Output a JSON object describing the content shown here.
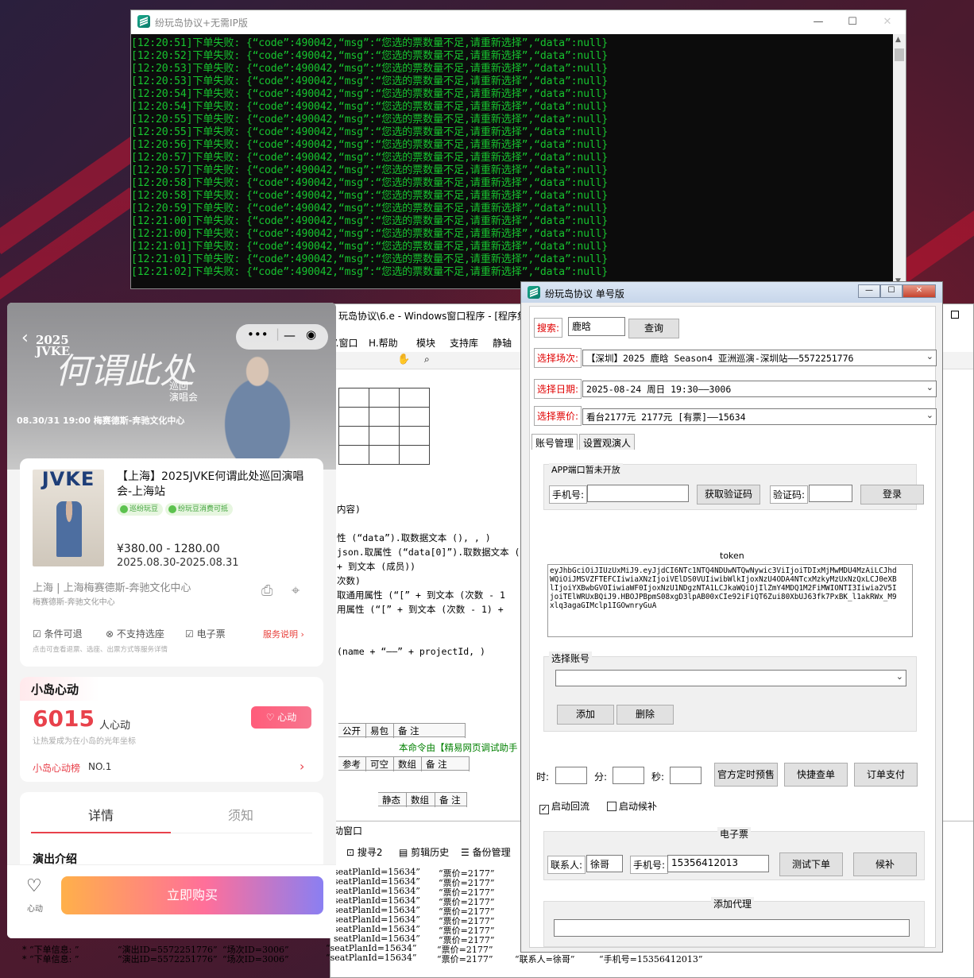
{
  "console": {
    "title": "纷玩岛协议+无需IP版",
    "lines": [
      "[12:20:51]下单失败: {“code”:490042,“msg”:“您选的票数量不足,请重新选择”,“data”:null}",
      "[12:20:52]下单失败: {“code”:490042,“msg”:“您选的票数量不足,请重新选择”,“data”:null}",
      "[12:20:53]下单失败: {“code”:490042,“msg”:“您选的票数量不足,请重新选择”,“data”:null}",
      "[12:20:53]下单失败: {“code”:490042,“msg”:“您选的票数量不足,请重新选择”,“data”:null}",
      "[12:20:54]下单失败: {“code”:490042,“msg”:“您选的票数量不足,请重新选择”,“data”:null}",
      "[12:20:54]下单失败: {“code”:490042,“msg”:“您选的票数量不足,请重新选择”,“data”:null}",
      "[12:20:55]下单失败: {“code”:490042,“msg”:“您选的票数量不足,请重新选择”,“data”:null}",
      "[12:20:55]下单失败: {“code”:490042,“msg”:“您选的票数量不足,请重新选择”,“data”:null}",
      "[12:20:56]下单失败: {“code”:490042,“msg”:“您选的票数量不足,请重新选择”,“data”:null}",
      "[12:20:57]下单失败: {“code”:490042,“msg”:“您选的票数量不足,请重新选择”,“data”:null}",
      "[12:20:57]下单失败: {“code”:490042,“msg”:“您选的票数量不足,请重新选择”,“data”:null}",
      "[12:20:58]下单失败: {“code”:490042,“msg”:“您选的票数量不足,请重新选择”,“data”:null}",
      "[12:20:58]下单失败: {“code”:490042,“msg”:“您选的票数量不足,请重新选择”,“data”:null}",
      "[12:20:59]下单失败: {“code”:490042,“msg”:“您选的票数量不足,请重新选择”,“data”:null}",
      "[12:21:00]下单失败: {“code”:490042,“msg”:“您选的票数量不足,请重新选择”,“data”:null}",
      "[12:21:00]下单失败: {“code”:490042,“msg”:“您选的票数量不足,请重新选择”,“data”:null}",
      "[12:21:01]下单失败: {“code”:490042,“msg”:“您选的票数量不足,请重新选择”,“data”:null}",
      "[12:21:01]下单失败: {“code”:490042,“msg”:“您选的票数量不足,请重新选择”,“data”:null}",
      "[12:21:02]下单失败: {“code”:490042,“msg”:“您选的票数量不足,请重新选择”,“data”:null}"
    ]
  },
  "ticket_app": {
    "title": "纷玩岛协议 单号版",
    "search_label": "搜索:",
    "search_value": "鹿晗",
    "query_button": "查询",
    "session_label": "选择场次:",
    "session_value": "【深圳】2025 鹿晗 Season4 亚洲巡演-深圳站——5572251776",
    "date_label": "选择日期:",
    "date_value": "2025-08-24 周日 19:30——3006",
    "price_label": "选择票价:",
    "price_value": "看台2177元 2177元 [有票]——15634",
    "tabs": [
      "账号管理",
      "设置观演人"
    ],
    "app_port_note": "APP端口暂未开放",
    "phone_label": "手机号:",
    "get_code_button": "获取验证码",
    "code_label": "验证码:",
    "login_button": "登录",
    "token_caption": "token",
    "token_value": "eyJhbGciOiJIUzUxMiJ9.eyJjdCI6NTc1NTQ4NDUwNTQwNywic3ViIjoiTDIxMjMwMDU4MzAiLCJhdWQiOiJMSVZFTEFCIiwiaXNzIjoiVElDS0VUIiwibWlkIjoxNzU4ODA4NTcxMzkyMzUxNzQxLCJ0eXBlIjoiYXBwbGVOIiwiaWF0IjoxNzU1NDgzNTA1LCJkaWQiOjIlZmY4MDQ1M2FiMWIONTI3Iiwia2V5IjoiTElWRUxBQiJ9.HBOJPBpmS08xgD3lpAB00xCIe92iFiQT6Zui80XbUJ63fk7PxBK_l1akRWx_M9xlq3agaGIMclp1IGOwnryGuA",
    "account_caption": "选择账号",
    "add_button": "添加",
    "delete_button": "删除",
    "hour_label": "时:",
    "minute_label": "分:",
    "second_label": "秒:",
    "official_presale_button": "官方定时预售",
    "quick_order_button": "快捷查单",
    "pay_button": "订单支付",
    "enable_reflow": "启动回流",
    "enable_standby": "启动候补",
    "eticket_caption": "电子票",
    "contact_label": "联系人:",
    "contact_value": "徐哥",
    "contact_phone_label": "手机号:",
    "contact_phone_value": "15356412013",
    "test_order_button": "测试下单",
    "standby_button": "候补",
    "proxy_caption": "添加代理"
  },
  "ide": {
    "title": "玩岛协议\\6.e - Windows窗口程序 - [程序集",
    "menu": [
      "V.窗口",
      "H.帮助",
      "模块",
      "支持库",
      "静轴"
    ],
    "code": [
      "内容)",
      "性 (“data”).取数据文本 (), , )",
      "json.取属性 (“data[0]”).取数据文本 ()",
      "+ 到文本 (成员))",
      "次数)",
      "取通用属性 (“[” + 到文本 (次数 - 1",
      "用属性 (“[” + 到文本 (次数 - 1) +",
      "(name + “——” + projectId, )"
    ],
    "table_headers_1": [
      "公开",
      "易包",
      "备 注"
    ],
    "green_note": "本命令由【精易网页调试助手",
    "table_headers_2": [
      "参考",
      "可空",
      "数组",
      "备 注"
    ],
    "table_headers_3": [
      "静态",
      "数组",
      "备 注"
    ],
    "bottom_tab": "动窗口",
    "bottom_tools": [
      "搜寻2",
      "剪辑历史",
      "备份管理"
    ],
    "log_rows": [
      {
        "a": "",
        "b": "",
        "c": "",
        "d": "seatPlanId=15634”",
        "e": "“票价=2177”"
      },
      {
        "a": "",
        "b": "",
        "c": "",
        "d": "seatPlanId=15634”",
        "e": "“票价=2177”"
      },
      {
        "a": "",
        "b": "",
        "c": "",
        "d": "seatPlanId=15634”",
        "e": "“票价=2177”"
      },
      {
        "a": "",
        "b": "",
        "c": "",
        "d": "seatPlanId=15634”",
        "e": "“票价=2177”"
      },
      {
        "a": "",
        "b": "",
        "c": "",
        "d": "seatPlanId=15634”",
        "e": "“票价=2177”"
      },
      {
        "a": "",
        "b": "",
        "c": "",
        "d": "seatPlanId=15634”",
        "e": "“票价=2177”"
      },
      {
        "a": "",
        "b": "",
        "c": "",
        "d": "seatPlanId=15634”",
        "e": "“票价=2177”"
      },
      {
        "a": "",
        "b": "",
        "c": "",
        "d": "seatPlanId=15634”",
        "e": "“票价=2177”"
      },
      {
        "a": "* “下单信息: ”",
        "b": "“演出ID=5572251776”",
        "c": "“场次ID=3006”",
        "d": "“seatPlanId=15634”",
        "e": "“票价=2177”"
      },
      {
        "a": "* “下单信息: ”",
        "b": "“演出ID=5572251776”",
        "c": "“场次ID=3006”",
        "d": "“seatPlanId=15634”",
        "e": "“票价=2177”",
        "f": "“联系人=徐哥”",
        "g": "“手机号=15356412013”"
      }
    ]
  },
  "phone": {
    "hero_year": "2025\nJVKE",
    "hero_script": "何谓此处",
    "hero_sub": "巡回\n演唱会",
    "hero_date": "08.30/31 19:00  梅赛德斯-奔驰文化中心",
    "poster_title": "JVKE",
    "event_title": "【上海】2025JVKE何谓此处巡回演唱会-上海站",
    "pill_1": "巡纷玩豆",
    "pill_2": "纷玩豆消费可抵",
    "price_range": "¥380.00 - 1280.00",
    "date_range": "2025.08.30-2025.08.31",
    "venue": "上海 | 上海梅赛德斯-奔驰文化中心",
    "venue_sub": "梅赛德斯-奔驰文化中心",
    "rule_1": "条件可退",
    "rule_2": "不支持选座",
    "rule_3": "电子票",
    "service_note": "服务说明",
    "rules_note": "点击可查看退票、选座、出票方式等服务详情",
    "island_title": "小岛心动",
    "heart_count": "6015",
    "heart_unit": "人心动",
    "heart_note": "让热爱成为在小岛的光年坐标",
    "love_button": "心动",
    "rank_label": "小岛心动榜",
    "rank_value": "NO.1",
    "tab_detail": "详情",
    "tab_notice": "须知",
    "intro_title": "演出介绍",
    "fav_label": "心动",
    "buy_button": "立即购买"
  },
  "colors": {
    "console_text": "#17c32f",
    "red_label": "#e00000",
    "accent_red": "#e8414b"
  }
}
